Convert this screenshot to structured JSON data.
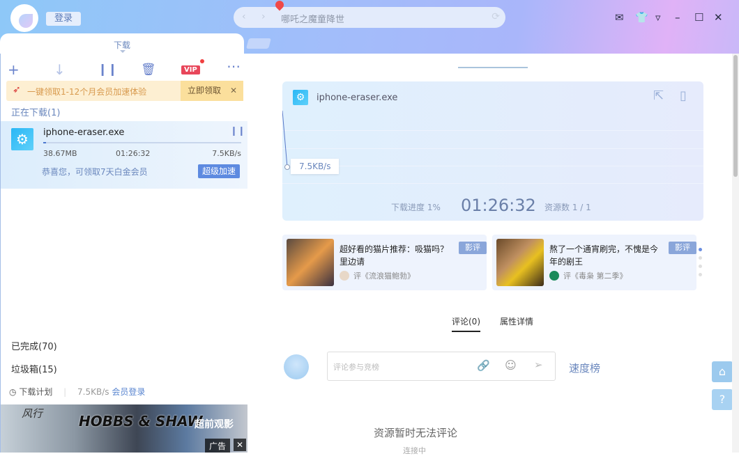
{
  "header": {
    "login_label": "登录",
    "search_value": "哪吒之魔童降世",
    "tab_label": "下载"
  },
  "toolbar": {
    "vip_label": "VIP"
  },
  "promo": {
    "text": "一键领取1-12个月会员加速体验",
    "claim_label": "立即领取",
    "close": "✕"
  },
  "downloading": {
    "title": "正在下载(1)",
    "item": {
      "name": "iphone-eraser.exe",
      "size": "38.67MB",
      "time_left": "01:26:32",
      "speed": "7.5KB/s",
      "progress_percent": 1,
      "offer": "恭喜您，可领取7天白金会员",
      "boost_label": "超级加速"
    }
  },
  "categories": {
    "completed": "已完成(70)",
    "trash": "垃圾箱(15)"
  },
  "footer": {
    "schedule": "下载计划",
    "speed": "7.5KB/s",
    "member_login": "会员登录"
  },
  "ad": {
    "brand": "风行",
    "title": "HOBBS & SHAW",
    "badge": "超前观影",
    "label": "广告"
  },
  "detail": {
    "file_name": "iphone-eraser.exe",
    "speed_tip": "7.5KB/s",
    "progress_label": "下载进度 1%",
    "time": "01:26:32",
    "sources": "资源数 1 / 1"
  },
  "reviews": [
    {
      "title": "超好看的猫片推荐：吸猫吗？里边请",
      "tag": "影评",
      "by": "评《流浪猫鲍勃》"
    },
    {
      "title": "熬了一个通宵刷完，不愧是今年的剧王",
      "tag": "影评",
      "by": "评《毒枭 第二季》"
    }
  ],
  "tabs": {
    "comments": "评论(0)",
    "properties": "属性详情"
  },
  "comment": {
    "placeholder": "评论参与竞榜",
    "ranking": "速度榜",
    "empty": "资源暂时无法评论",
    "status": "连接中"
  }
}
